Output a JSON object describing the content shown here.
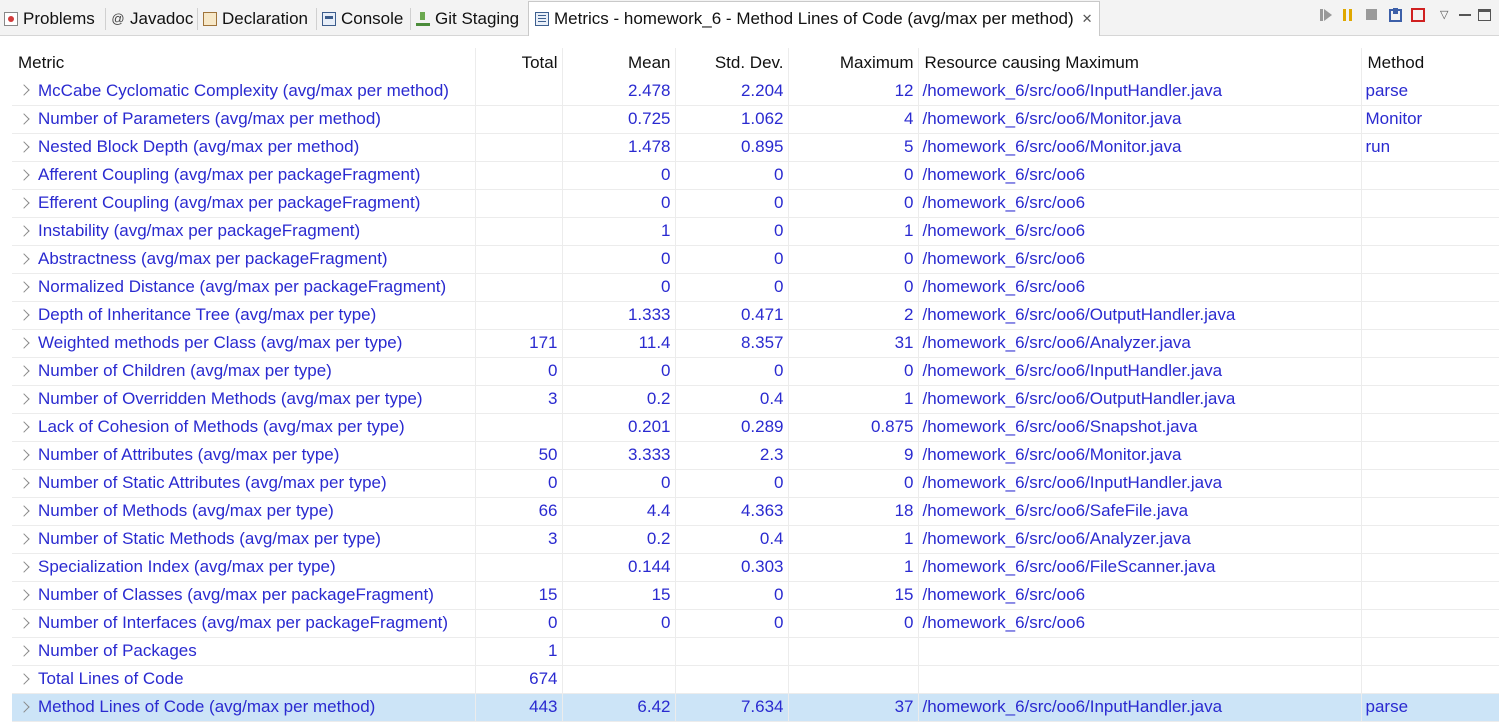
{
  "tabs": [
    {
      "label": "Problems",
      "icon": "problems-icon"
    },
    {
      "label": "Javadoc",
      "icon": "javadoc-icon"
    },
    {
      "label": "Declaration",
      "icon": "declaration-icon"
    },
    {
      "label": "Console",
      "icon": "console-icon"
    },
    {
      "label": "Git Staging",
      "icon": "git-staging-icon"
    },
    {
      "label": "Metrics - homework_6 - Method Lines of Code (avg/max per method)",
      "icon": "metrics-icon",
      "active": true
    }
  ],
  "close_glyph": "✕",
  "toolbar_icons": [
    "run-icon",
    "pause-icon",
    "stop-icon",
    "export-icon",
    "layout-icon",
    "view-menu-icon",
    "minimize-icon",
    "maximize-icon"
  ],
  "colors": {
    "default_text": "#2a2ad0",
    "warning_text": "#e32222",
    "selected_row_bg": "#cce4f7"
  },
  "table": {
    "headers": {
      "metric": "Metric",
      "total": "Total",
      "mean": "Mean",
      "std": "Std. Dev.",
      "max": "Maximum",
      "resource": "Resource causing Maximum",
      "method": "Method"
    },
    "rows": [
      {
        "metric": "McCabe Cyclomatic Complexity (avg/max per method)",
        "total": "",
        "mean": "2.478",
        "std": "2.204",
        "max": "12",
        "resource": "/homework_6/src/oo6/InputHandler.java",
        "method": "parse",
        "state": "warn"
      },
      {
        "metric": "Number of Parameters (avg/max per method)",
        "total": "",
        "mean": "0.725",
        "std": "1.062",
        "max": "4",
        "resource": "/homework_6/src/oo6/Monitor.java",
        "method": "Monitor"
      },
      {
        "metric": "Nested Block Depth (avg/max per method)",
        "total": "",
        "mean": "1.478",
        "std": "0.895",
        "max": "5",
        "resource": "/homework_6/src/oo6/Monitor.java",
        "method": "run"
      },
      {
        "metric": "Afferent Coupling (avg/max per packageFragment)",
        "total": "",
        "mean": "0",
        "std": "0",
        "max": "0",
        "resource": "/homework_6/src/oo6",
        "method": ""
      },
      {
        "metric": "Efferent Coupling (avg/max per packageFragment)",
        "total": "",
        "mean": "0",
        "std": "0",
        "max": "0",
        "resource": "/homework_6/src/oo6",
        "method": ""
      },
      {
        "metric": "Instability (avg/max per packageFragment)",
        "total": "",
        "mean": "1",
        "std": "0",
        "max": "1",
        "resource": "/homework_6/src/oo6",
        "method": ""
      },
      {
        "metric": "Abstractness (avg/max per packageFragment)",
        "total": "",
        "mean": "0",
        "std": "0",
        "max": "0",
        "resource": "/homework_6/src/oo6",
        "method": ""
      },
      {
        "metric": "Normalized Distance (avg/max per packageFragment)",
        "total": "",
        "mean": "0",
        "std": "0",
        "max": "0",
        "resource": "/homework_6/src/oo6",
        "method": ""
      },
      {
        "metric": "Depth of Inheritance Tree (avg/max per type)",
        "total": "",
        "mean": "1.333",
        "std": "0.471",
        "max": "2",
        "resource": "/homework_6/src/oo6/OutputHandler.java",
        "method": ""
      },
      {
        "metric": "Weighted methods per Class (avg/max per type)",
        "total": "171",
        "mean": "11.4",
        "std": "8.357",
        "max": "31",
        "resource": "/homework_6/src/oo6/Analyzer.java",
        "method": ""
      },
      {
        "metric": "Number of Children (avg/max per type)",
        "total": "0",
        "mean": "0",
        "std": "0",
        "max": "0",
        "resource": "/homework_6/src/oo6/InputHandler.java",
        "method": ""
      },
      {
        "metric": "Number of Overridden Methods (avg/max per type)",
        "total": "3",
        "mean": "0.2",
        "std": "0.4",
        "max": "1",
        "resource": "/homework_6/src/oo6/OutputHandler.java",
        "method": ""
      },
      {
        "metric": "Lack of Cohesion of Methods (avg/max per type)",
        "total": "",
        "mean": "0.201",
        "std": "0.289",
        "max": "0.875",
        "resource": "/homework_6/src/oo6/Snapshot.java",
        "method": ""
      },
      {
        "metric": "Number of Attributes (avg/max per type)",
        "total": "50",
        "mean": "3.333",
        "std": "2.3",
        "max": "9",
        "resource": "/homework_6/src/oo6/Monitor.java",
        "method": ""
      },
      {
        "metric": "Number of Static Attributes (avg/max per type)",
        "total": "0",
        "mean": "0",
        "std": "0",
        "max": "0",
        "resource": "/homework_6/src/oo6/InputHandler.java",
        "method": ""
      },
      {
        "metric": "Number of Methods (avg/max per type)",
        "total": "66",
        "mean": "4.4",
        "std": "4.363",
        "max": "18",
        "resource": "/homework_6/src/oo6/SafeFile.java",
        "method": ""
      },
      {
        "metric": "Number of Static Methods (avg/max per type)",
        "total": "3",
        "mean": "0.2",
        "std": "0.4",
        "max": "1",
        "resource": "/homework_6/src/oo6/Analyzer.java",
        "method": ""
      },
      {
        "metric": "Specialization Index (avg/max per type)",
        "total": "",
        "mean": "0.144",
        "std": "0.303",
        "max": "1",
        "resource": "/homework_6/src/oo6/FileScanner.java",
        "method": ""
      },
      {
        "metric": "Number of Classes (avg/max per packageFragment)",
        "total": "15",
        "mean": "15",
        "std": "0",
        "max": "15",
        "resource": "/homework_6/src/oo6",
        "method": ""
      },
      {
        "metric": "Number of Interfaces (avg/max per packageFragment)",
        "total": "0",
        "mean": "0",
        "std": "0",
        "max": "0",
        "resource": "/homework_6/src/oo6",
        "method": ""
      },
      {
        "metric": "Number of Packages",
        "total": "1",
        "mean": "",
        "std": "",
        "max": "",
        "resource": "",
        "method": ""
      },
      {
        "metric": "Total Lines of Code",
        "total": "674",
        "mean": "",
        "std": "",
        "max": "",
        "resource": "",
        "method": ""
      },
      {
        "metric": "Method Lines of Code (avg/max per method)",
        "total": "443",
        "mean": "6.42",
        "std": "7.634",
        "max": "37",
        "resource": "/homework_6/src/oo6/InputHandler.java",
        "method": "parse",
        "state": "selected"
      }
    ]
  }
}
